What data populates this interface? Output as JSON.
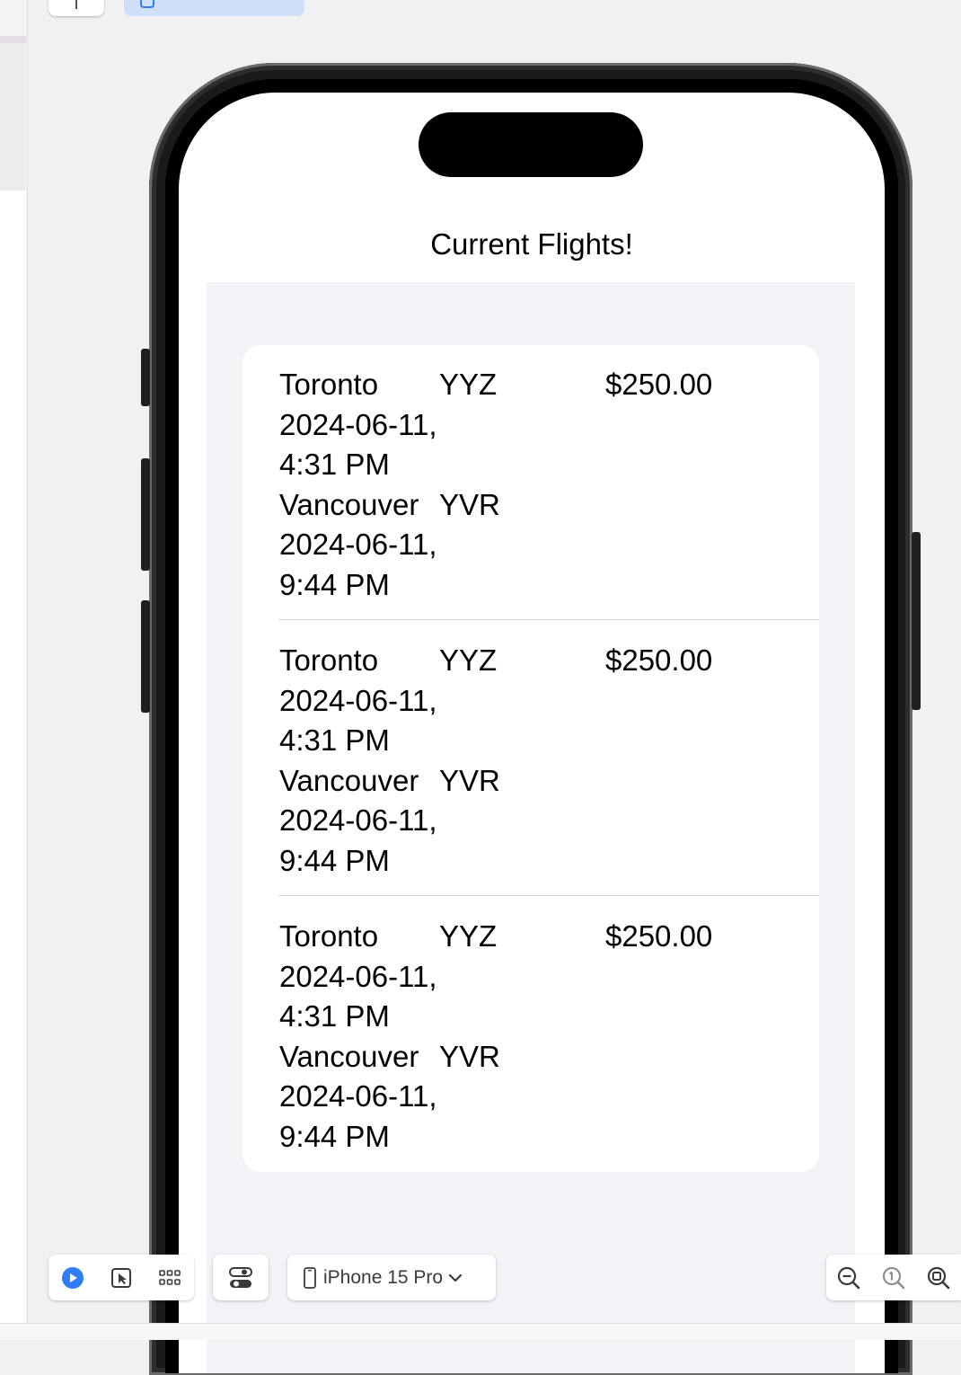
{
  "app": {
    "screen_title": "Current Flights!"
  },
  "flights": [
    {
      "origin_city": "Toronto",
      "origin_code": "YYZ",
      "departure_date": "2024-06-11,",
      "departure_time": "4:31 PM",
      "dest_city": "Vancouver",
      "dest_code": "YVR",
      "arrival_date": "2024-06-11,",
      "arrival_time": "9:44 PM",
      "price": "$250.00"
    },
    {
      "origin_city": "Toronto",
      "origin_code": "YYZ",
      "departure_date": "2024-06-11,",
      "departure_time": "4:31 PM",
      "dest_city": "Vancouver",
      "dest_code": "YVR",
      "arrival_date": "2024-06-11,",
      "arrival_time": "9:44 PM",
      "price": "$250.00"
    },
    {
      "origin_city": "Toronto",
      "origin_code": "YYZ",
      "departure_date": "2024-06-11,",
      "departure_time": "4:31 PM",
      "dest_city": "Vancouver",
      "dest_code": "YVR",
      "arrival_date": "2024-06-11,",
      "arrival_time": "9:44 PM",
      "price": "$250.00"
    }
  ],
  "preview_toolbar": {
    "live_icon": "play-circle-icon",
    "selectable_icon": "cursor-select-icon",
    "variants_icon": "grid-icon",
    "settings_icon": "canvas-settings-icon",
    "device_icon": "iphone-icon",
    "device_name": "iPhone 15 Pro",
    "dropdown_icon": "chevron-down-icon",
    "zoom_out_icon": "zoom-out-icon",
    "zoom_actual_icon": "zoom-100-icon",
    "zoom_fit_icon": "zoom-fit-icon",
    "accent_color": "#2f7cf6"
  }
}
